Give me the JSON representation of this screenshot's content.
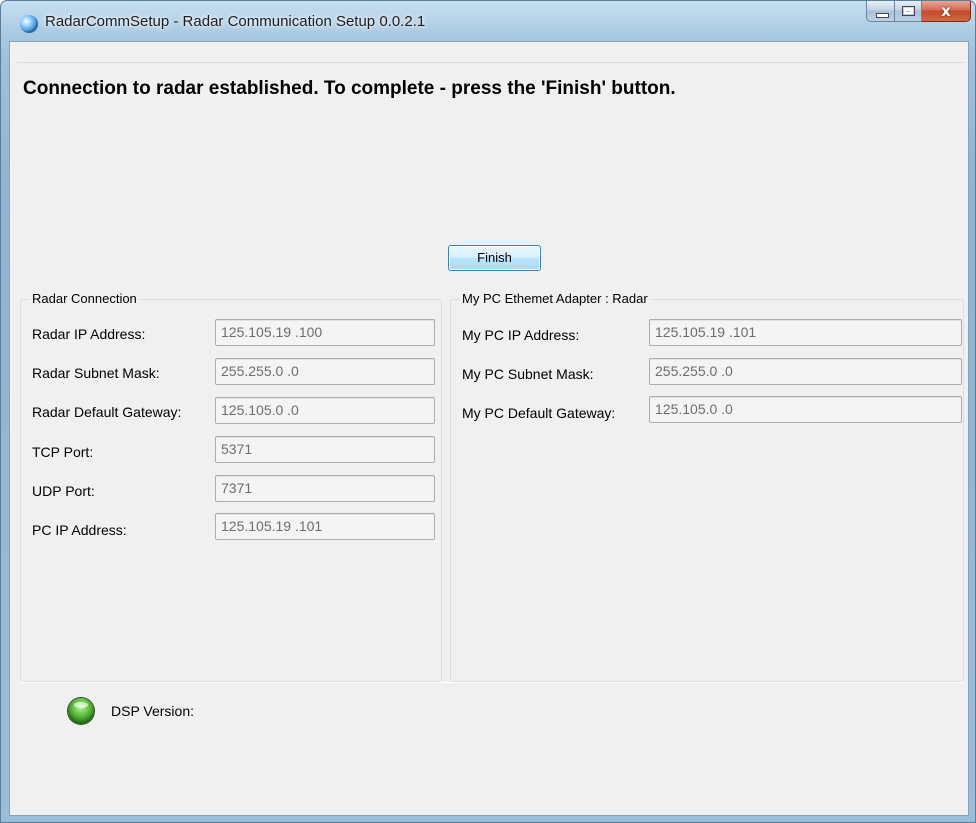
{
  "window": {
    "title": "RadarCommSetup - Radar Communication  Setup 0.0.2.1",
    "close_glyph": "x"
  },
  "status_message": "Connection to radar established. To complete - press the 'Finish' button.",
  "finish_button": {
    "label": "Finish"
  },
  "radar_connection": {
    "title": "Radar Connection",
    "fields": [
      {
        "label": "Radar IP Address:",
        "value": "125.105.19 .100"
      },
      {
        "label": "Radar Subnet Mask:",
        "value": "255.255.0  .0"
      },
      {
        "label": "Radar Default Gateway:",
        "value": "125.105.0  .0"
      },
      {
        "label": "TCP Port:",
        "value": "5371"
      },
      {
        "label": "UDP Port:",
        "value": "7371"
      },
      {
        "label": "PC IP Address:",
        "value": "125.105.19 .101"
      }
    ]
  },
  "pc_adapter": {
    "title": "My PC Ethemet Adapter : Radar",
    "fields": [
      {
        "label": "My PC IP Address:",
        "value": "125.105.19 .101"
      },
      {
        "label": "My PC Subnet Mask:",
        "value": "255.255.0  .0"
      },
      {
        "label": "My PC Default Gateway:",
        "value": "125.105.0  .0"
      }
    ]
  },
  "dsp": {
    "label": "DSP Version:",
    "value": "",
    "led_color": "#3b9a23"
  },
  "icons": [
    "app-globe-icon",
    "minimize-icon",
    "maximize-icon",
    "close-icon",
    "status-led-icon"
  ]
}
